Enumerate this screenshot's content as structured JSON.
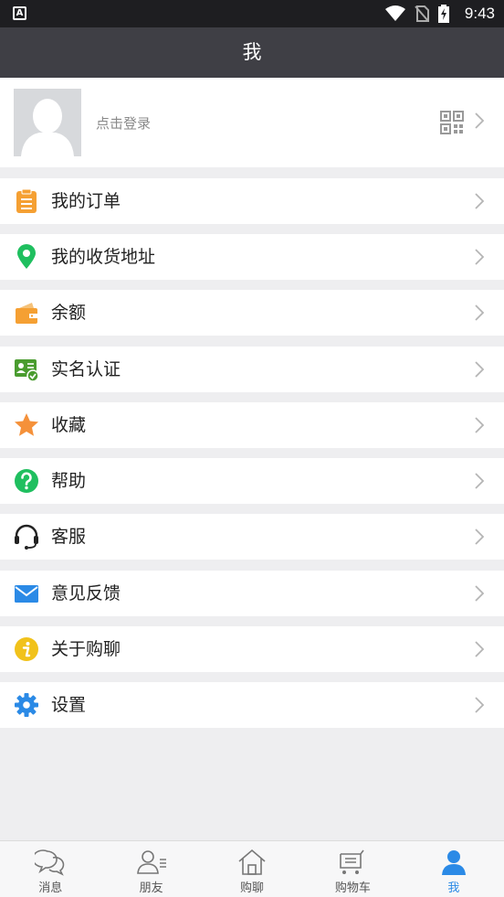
{
  "status_bar": {
    "app_badge": "A",
    "time": "9:43"
  },
  "header": {
    "title": "我"
  },
  "profile": {
    "login_text": "点击登录"
  },
  "menu": [
    {
      "label": "我的订单",
      "icon": "order-list-icon"
    },
    {
      "label": "我的收货地址",
      "icon": "location-pin-icon"
    },
    {
      "label": "余额",
      "icon": "wallet-icon"
    },
    {
      "label": "实名认证",
      "icon": "id-card-verified-icon"
    },
    {
      "label": "收藏",
      "icon": "star-icon"
    },
    {
      "label": "帮助",
      "icon": "help-question-icon"
    },
    {
      "label": "客服",
      "icon": "headset-icon"
    },
    {
      "label": "意见反馈",
      "icon": "envelope-icon"
    },
    {
      "label": "关于购聊",
      "icon": "info-icon"
    },
    {
      "label": "设置",
      "icon": "gear-icon"
    }
  ],
  "bottom_nav": [
    {
      "label": "消息",
      "icon": "chat-bubbles-icon"
    },
    {
      "label": "朋友",
      "icon": "friends-icon"
    },
    {
      "label": "购聊",
      "icon": "home-icon"
    },
    {
      "label": "购物车",
      "icon": "cart-icon"
    },
    {
      "label": "我",
      "icon": "person-icon",
      "active": true
    }
  ],
  "colors": {
    "title_bar": "#3f3f45",
    "status_bar": "#1e1e21",
    "background": "#eeeef0",
    "active_tab": "#2b8ae6",
    "order_icon": "#f5a033",
    "location_icon": "#1fbf5f",
    "wallet_icon": "#f5a033",
    "id_icon": "#4a9c2f",
    "star_icon": "#f5913a",
    "help_icon": "#1fbf5f",
    "mail_icon": "#2b8ae6",
    "info_icon": "#f1c21b",
    "gear_icon": "#2b8ae6"
  }
}
